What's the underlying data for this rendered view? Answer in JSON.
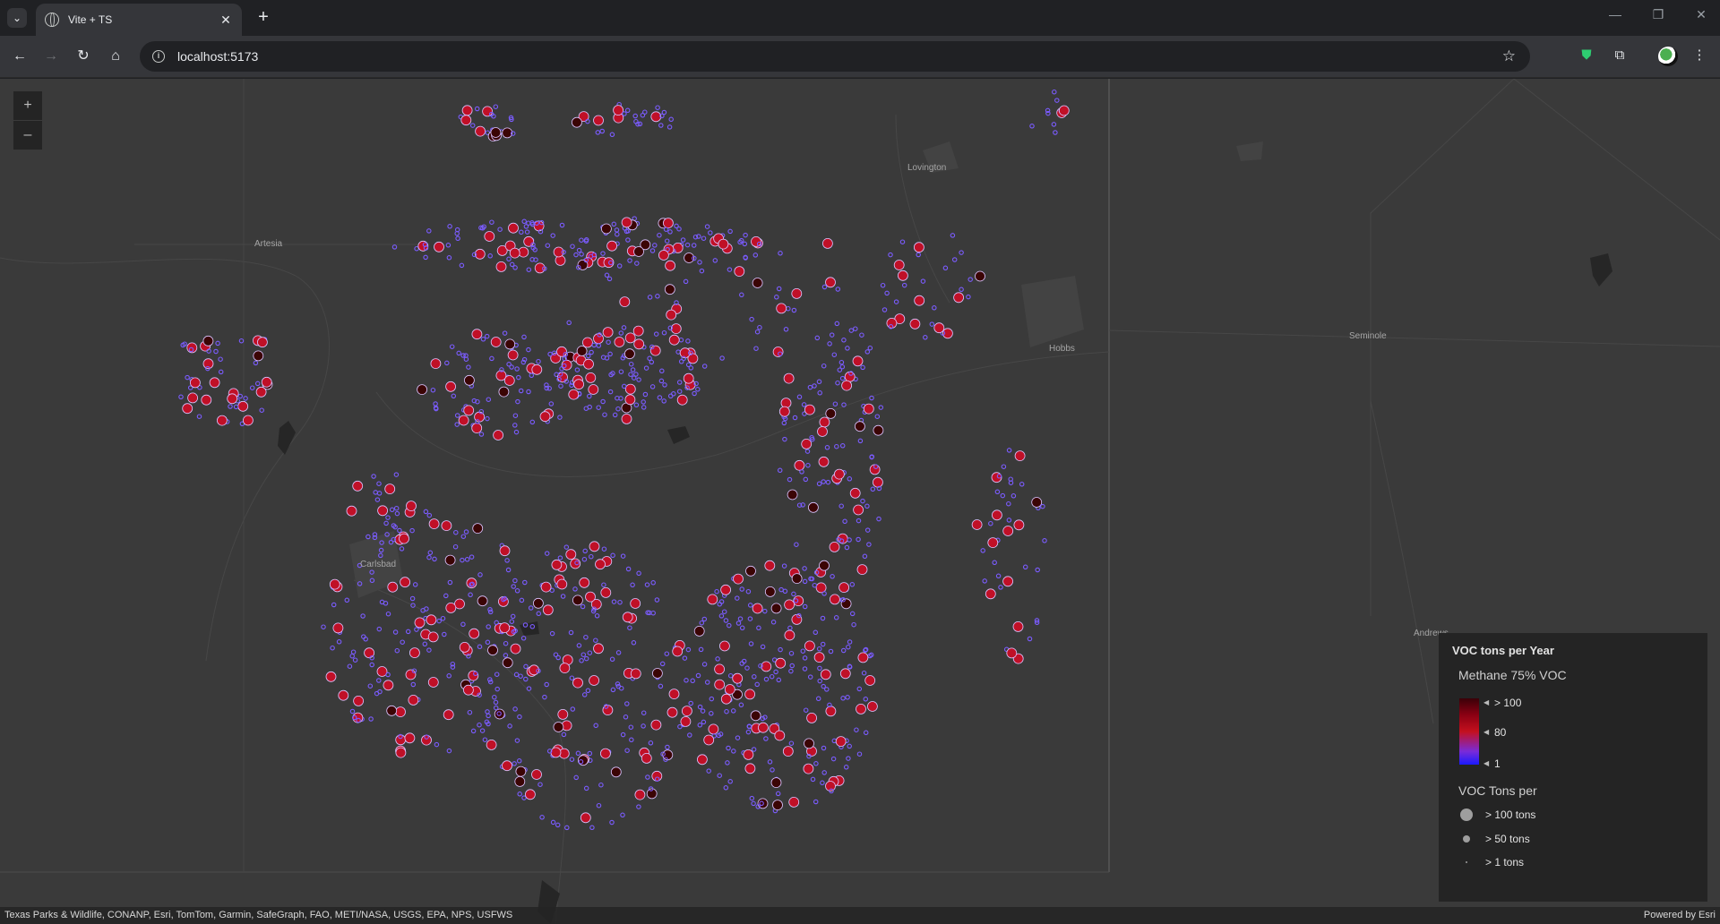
{
  "browser": {
    "tab_title": "Vite + TS",
    "tab_close": "✕",
    "new_tab": "+",
    "url": "localhost:5173",
    "min_glyph": "—",
    "restore_glyph": "❐",
    "close_glyph": "✕"
  },
  "map": {
    "zoom_in": "+",
    "zoom_out": "–",
    "cities": {
      "lovington": "Lovington",
      "artesia": "Artesia",
      "hobbs": "Hobbs",
      "seminole": "Seminole",
      "carlsbad": "Carlsbad",
      "andrews": "Andrews"
    },
    "attribution": "Texas Parks & Wildlife, CONANP, Esri, TomTom, Garmin, SafeGraph, FAO, METI/NASA, USGS, EPA, NPS, USFWS",
    "powered_by": "Powered by Esri"
  },
  "legend": {
    "title": "VOC tons per Year",
    "color_title": "Methane 75% VOC",
    "color_stops": [
      "> 100",
      "80",
      "1"
    ],
    "size_title": "VOC Tons per",
    "size_items": [
      "> 100 tons",
      "> 50 tons",
      "> 1 tons"
    ]
  },
  "colors": {
    "map_bg": "#3a3a3a",
    "point_low": "#7b5cff",
    "point_mid": "#c01027",
    "point_high": "#3b0505"
  }
}
